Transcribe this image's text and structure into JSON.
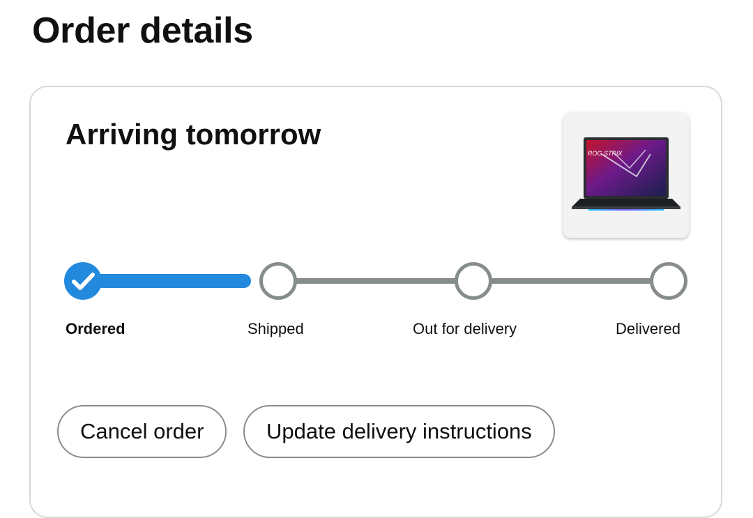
{
  "page": {
    "title": "Order details"
  },
  "shipment": {
    "status_heading": "Arriving tomorrow",
    "product_image_label": "ROG STRIX",
    "progress": {
      "current_step": 0,
      "steps": [
        {
          "label": "Ordered",
          "completed": true
        },
        {
          "label": "Shipped",
          "completed": false
        },
        {
          "label": "Out for delivery",
          "completed": false
        },
        {
          "label": "Delivered",
          "completed": false
        }
      ]
    }
  },
  "actions": {
    "cancel_label": "Cancel order",
    "update_label": "Update delivery instructions"
  },
  "colors": {
    "accent": "#2389dd",
    "inactive_track": "#878c8c",
    "card_border": "#d5d9d9"
  }
}
